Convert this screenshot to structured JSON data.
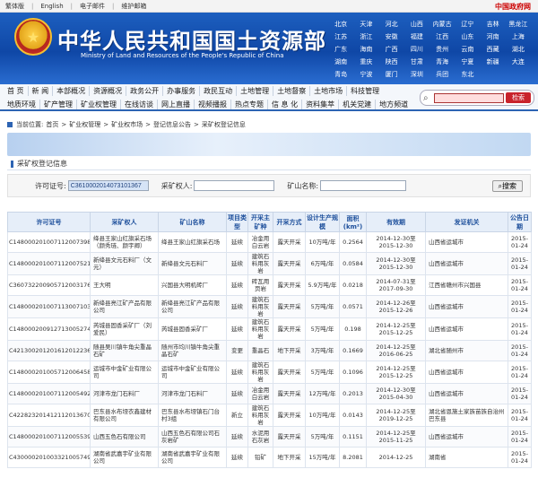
{
  "topbar": {
    "links": [
      "繁体版",
      "English",
      "电子邮件",
      "维护邮箱"
    ],
    "gov_link": "中国政府网"
  },
  "header": {
    "title": "中华人民共和国国土资源部",
    "subtitle": "Ministry of Land and Resources of the People's Republic of China",
    "regions": [
      "北京",
      "天津",
      "河北",
      "山西",
      "内蒙古",
      "辽宁",
      "吉林",
      "黑龙江",
      "江苏",
      "浙江",
      "安徽",
      "福建",
      "江西",
      "山东",
      "河南",
      "上海",
      "广东",
      "海南",
      "广西",
      "四川",
      "贵州",
      "云南",
      "西藏",
      "湖北",
      "湖南",
      "重庆",
      "陕西",
      "甘肃",
      "青海",
      "宁夏",
      "新疆",
      "大连",
      "青岛",
      "宁波",
      "厦门",
      "深圳",
      "兵团",
      "东北"
    ]
  },
  "nav": {
    "row1": [
      "首 页",
      "新 闻",
      "本部概况",
      "资源概况",
      "政务公开",
      "办事服务",
      "政民互动",
      "土地管理",
      "土地督察",
      "土地市场",
      "科技管理"
    ],
    "row2": [
      "地质环境",
      "矿产管理",
      "矿业权管理",
      "在线访谈",
      "网上直播",
      "视频播报",
      "热点专题",
      "信 息 化",
      "资料集萃",
      "机关党建",
      "地方频道"
    ],
    "search_button": "检索"
  },
  "breadcrumb": {
    "label": "当前位置:",
    "items": [
      "首页",
      ">",
      "矿业权管理",
      ">",
      "矿业权市场",
      ">",
      "登记信息公告",
      ">",
      "采矿权登记信息"
    ]
  },
  "section_title": "采矿权登记信息",
  "filters": {
    "permit_label": "许可证号:",
    "permit_value": "C3610002014073101367",
    "holder_label": "采矿权人:",
    "holder_value": "",
    "mine_label": "矿山名称:",
    "mine_value": "",
    "search_button": "搜索"
  },
  "table": {
    "headers": [
      "许可证号",
      "采矿权人",
      "矿山名称",
      "项目类型",
      "开采主矿种",
      "开采方式",
      "设计生产规模",
      "面积(km²)",
      "有效期",
      "发证机关",
      "公告日期"
    ],
    "rows": [
      [
        "C1480002010071120073985",
        "绛县王家山红旗采石场（颜秀琏、颜宇卿）",
        "绛县王家山红旗采石场",
        "延续",
        "冶金用白云岩",
        "露天开采",
        "10万吨/年",
        "0.2564",
        "2014-12-30至2015-12-30",
        "山西省运城市",
        "2015-01-24"
      ],
      [
        "C1480002010071120075217",
        "新绛县文元石料厂（文元）",
        "新绛县文元石料厂",
        "延续",
        "建筑石料用灰岩",
        "露天开采",
        "6万吨/年",
        "0.0584",
        "2014-12-30至2015-12-30",
        "山西省运城市",
        "2015-01-24"
      ],
      [
        "C3607322009057120031768",
        "王大明",
        "兴国县大明机砖厂",
        "延续",
        "砖瓦用页岩",
        "露天开采",
        "5.9万吨/年",
        "0.0218",
        "2014-07-31至2017-09-30",
        "江西省赣州市兴国县",
        "2015-01-24"
      ],
      [
        "C1480002010071130071034",
        "新绛县亮江矿产品有限公司",
        "新绛县亮江矿产品有限公司",
        "延续",
        "建筑石料用灰岩",
        "露天开采",
        "5万吨/年",
        "0.0571",
        "2014-12-26至2015-12-26",
        "山西省运城市",
        "2015-01-24"
      ],
      [
        "C1480002009127130052746",
        "芮城县固香采矿厂（刘爱民）",
        "芮城县固香采矿厂",
        "延续",
        "建筑石料用灰岩",
        "露天开采",
        "5万吨/年",
        "0.198",
        "2014-12-25至2015-12-25",
        "山西省运城市",
        "2015-01-24"
      ],
      [
        "C4213002012016120122360",
        "随县吴川镇牛角尖重晶石矿",
        "随州市均川镇牛角尖重晶石矿",
        "变更",
        "重晶石",
        "地下开采",
        "3万吨/年",
        "0.1669",
        "2014-12-25至2016-06-25",
        "湖北省随州市",
        "2015-01-24"
      ],
      [
        "C1480002010057120064589",
        "运城市中金矿业有限公司",
        "运城市中金矿业有限公司",
        "延续",
        "建筑石料用灰岩",
        "露天开采",
        "5万吨/年",
        "0.1096",
        "2014-12-25至2015-12-25",
        "山西省运城市",
        "2015-01-24"
      ],
      [
        "C1480002010071120054928",
        "河津市龙门石料厂",
        "河津市龙门石料厂",
        "延续",
        "冶金用白云岩",
        "露天开采",
        "12万吨/年",
        "0.2013",
        "2014-12-30至2015-04-30",
        "山西省运城市",
        "2015-01-24"
      ],
      [
        "C4228232014121120136702",
        "巴东县水布垭衣鑫建材有限公司",
        "巴东县水布垭镇石门台村3组",
        "新立",
        "建筑石料用灰岩",
        "露天开采",
        "10万吨/年",
        "0.0143",
        "2014-12-25至2019-12-25",
        "湖北省恩施土家族苗族自治州巴东县",
        "2015-01-24"
      ],
      [
        "C1480002010071120055396",
        "山西五色石有限公司",
        "山西五色石有限公司石灰岩矿",
        "延续",
        "水泥用石灰岩",
        "露天开采",
        "5万吨/年",
        "0.1151",
        "2014-12-25至2015-11-25",
        "山西省运城市",
        "2015-01-24"
      ],
      [
        "C4300002010033210057497",
        "湖南省武嘉宇矿业有限公司",
        "湖南省武嘉宇矿业有限公司",
        "延续",
        "铅矿",
        "地下开采",
        "15万吨/年",
        "8.2081",
        "2014-12-25",
        "湖南省",
        "2015-01-24"
      ]
    ]
  }
}
